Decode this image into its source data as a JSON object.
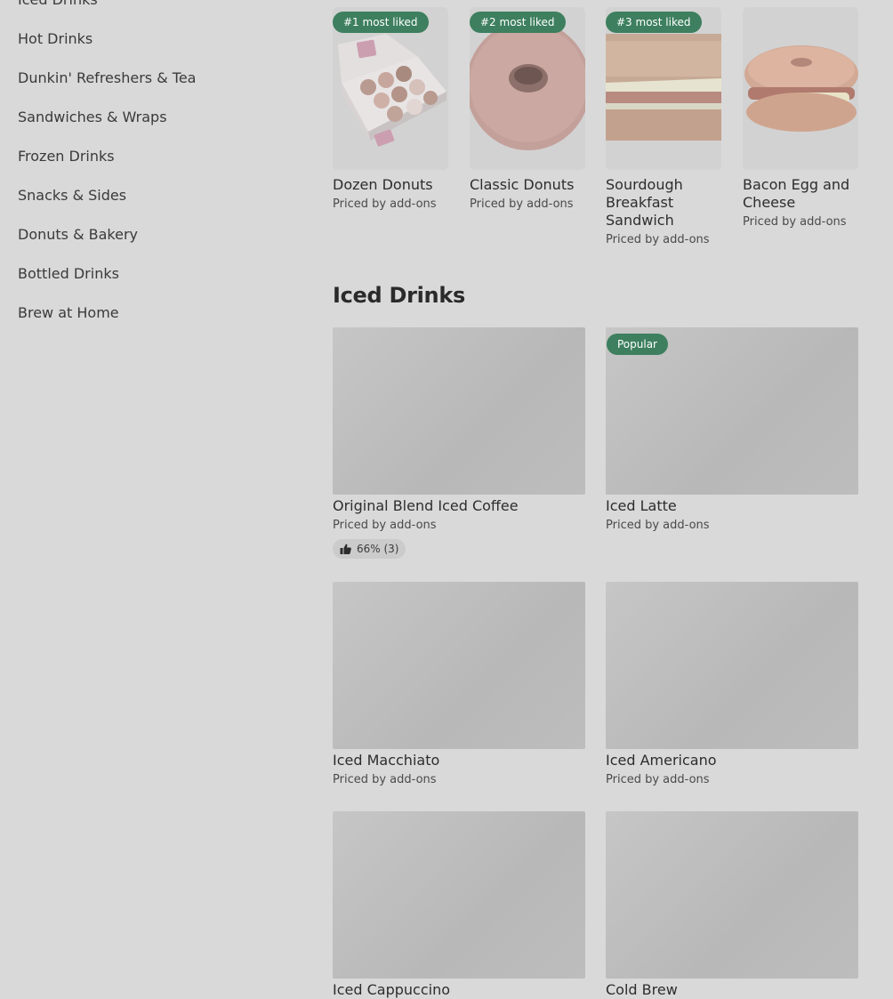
{
  "sidebar": {
    "items": [
      {
        "label": "Iced Drinks"
      },
      {
        "label": "Hot Drinks"
      },
      {
        "label": "Dunkin' Refreshers & Tea"
      },
      {
        "label": "Sandwiches & Wraps"
      },
      {
        "label": "Frozen Drinks"
      },
      {
        "label": "Snacks & Sides"
      },
      {
        "label": "Donuts & Bakery"
      },
      {
        "label": "Bottled Drinks"
      },
      {
        "label": "Brew at Home"
      }
    ]
  },
  "featured": [
    {
      "name": "Dozen Donuts",
      "price": "Priced by add-ons",
      "badge": "#1 most liked"
    },
    {
      "name": "Classic Donuts",
      "price": "Priced by add-ons",
      "badge": "#2 most liked"
    },
    {
      "name": "Sourdough Breakfast Sandwich",
      "price": "Priced by add-ons",
      "badge": "#3 most liked"
    },
    {
      "name": "Bacon Egg and Cheese",
      "price": "Priced by add-ons"
    }
  ],
  "iced_drinks": {
    "title": "Iced Drinks",
    "items": [
      {
        "name": "Original Blend Iced Coffee",
        "price": "Priced by add-ons",
        "rating": "66% (3)"
      },
      {
        "name": "Iced Latte",
        "price": "Priced by add-ons",
        "badge": "Popular"
      },
      {
        "name": "Iced Macchiato",
        "price": "Priced by add-ons"
      },
      {
        "name": "Iced Americano",
        "price": "Priced by add-ons"
      },
      {
        "name": "Iced Cappuccino"
      },
      {
        "name": "Cold Brew"
      }
    ]
  },
  "colors": {
    "badge": "#3d7f5e",
    "overlay_background": "#d9d9d9"
  },
  "icons": {
    "rating": "thumbs-up-icon"
  }
}
